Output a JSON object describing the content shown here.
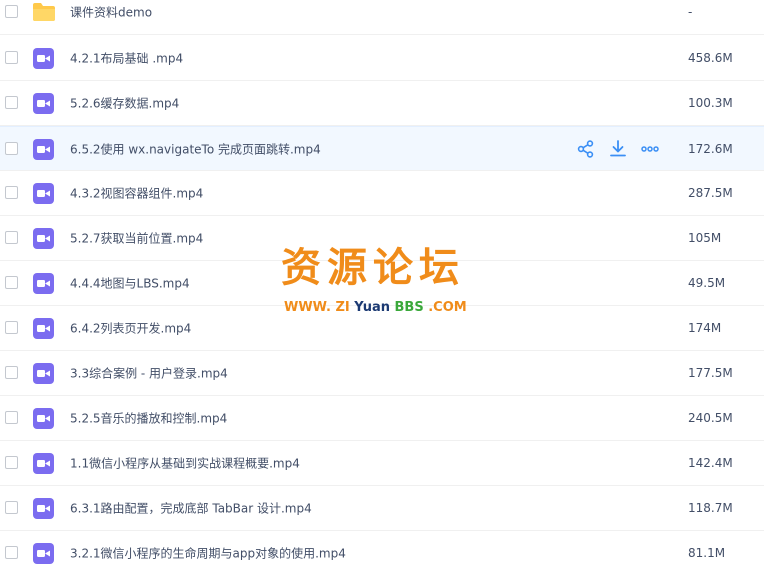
{
  "files": [
    {
      "name": "课件资料demo",
      "size": "-",
      "type": "folder"
    },
    {
      "name": "4.2.1布局基础 .mp4",
      "size": "458.6M",
      "type": "video"
    },
    {
      "name": "5.2.6缓存数据.mp4",
      "size": "100.3M",
      "type": "video"
    },
    {
      "name": "6.5.2使用 wx.navigateTo 完成页面跳转.mp4",
      "size": "172.6M",
      "type": "video"
    },
    {
      "name": "4.3.2视图容器组件.mp4",
      "size": "287.5M",
      "type": "video"
    },
    {
      "name": "5.2.7获取当前位置.mp4",
      "size": "105M",
      "type": "video"
    },
    {
      "name": "4.4.4地图与LBS.mp4",
      "size": "49.5M",
      "type": "video"
    },
    {
      "name": "6.4.2列表页开发.mp4",
      "size": "174M",
      "type": "video"
    },
    {
      "name": "3.3综合案例 - 用户登录.mp4",
      "size": "177.5M",
      "type": "video"
    },
    {
      "name": "5.2.5音乐的播放和控制.mp4",
      "size": "240.5M",
      "type": "video"
    },
    {
      "name": "1.1微信小程序从基础到实战课程概要.mp4",
      "size": "142.4M",
      "type": "video"
    },
    {
      "name": "6.3.1路由配置，完成底部 TabBar 设计.mp4",
      "size": "118.7M",
      "type": "video"
    },
    {
      "name": "3.2.1微信小程序的生命周期与app对象的使用.mp4",
      "size": "81.1M",
      "type": "video"
    }
  ],
  "row_actions_icons": [
    "share-icon",
    "download-icon",
    "more-icon"
  ],
  "colors": {
    "video_icon": "#7b6cf0",
    "folder_icon": "#ffc94a",
    "action_icon": "#3b8ff5",
    "hover_row": "#f2f8ff",
    "text": "#424e67"
  },
  "watermark": {
    "title": "资源论坛",
    "url_prefix": "WWW.",
    "url_zi": "ZI",
    "url_yuan": "Yuan",
    "url_bbs": "BBS",
    "url_suffix": ".COM"
  }
}
